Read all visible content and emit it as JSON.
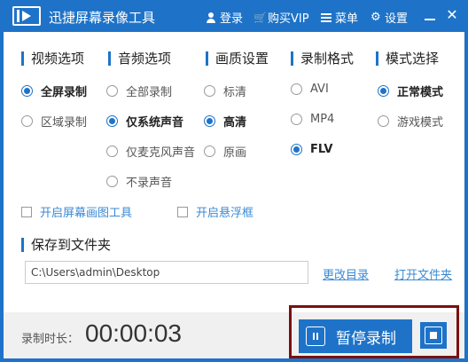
{
  "app": {
    "title": "迅捷屏幕录像工具"
  },
  "titlebar": {
    "login": "登录",
    "vip": "购买VIP",
    "menu": "菜单",
    "settings": "设置",
    "minimize": "—",
    "close": "✕"
  },
  "columns": {
    "video": {
      "title": "视频选项",
      "options": [
        "全屏录制",
        "区域录制"
      ],
      "selected": 0
    },
    "audio": {
      "title": "音频选项",
      "options": [
        "全部录制",
        "仅系统声音",
        "仅麦克风声音",
        "不录声音"
      ],
      "selected": 1
    },
    "quality": {
      "title": "画质设置",
      "options": [
        "标清",
        "高清",
        "原画"
      ],
      "selected": 1
    },
    "format": {
      "title": "录制格式",
      "options": [
        "AVI",
        "MP4",
        "FLV"
      ],
      "selected": 2
    },
    "mode": {
      "title": "模式选择",
      "options": [
        "正常模式",
        "游戏模式"
      ],
      "selected": 0
    }
  },
  "checkboxes": {
    "brush": "开启屏幕画图工具",
    "float": "开启悬浮框"
  },
  "save": {
    "title": "保存到文件夹",
    "path": "C:\\Users\\admin\\Desktop",
    "change": "更改目录",
    "open": "打开文件夹"
  },
  "status": {
    "label": "录制时长：",
    "time": "00:00:03"
  },
  "controls": {
    "pause": "暂停录制"
  },
  "colors": {
    "accent": "#1e73c8",
    "link": "#3a8ad6",
    "highlight": "#7b1010"
  }
}
